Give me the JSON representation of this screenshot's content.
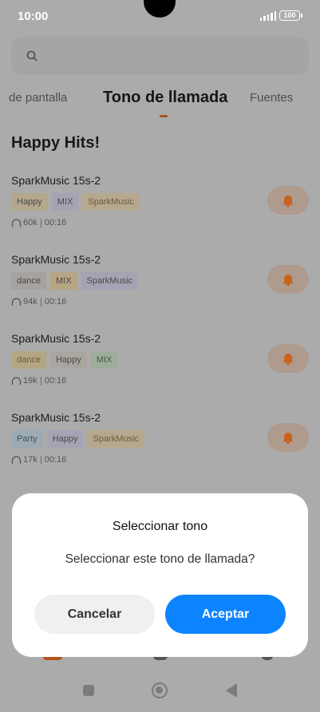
{
  "status_bar": {
    "time": "10:00",
    "battery": "100"
  },
  "search": {
    "placeholder": ""
  },
  "tabs": [
    {
      "label": "de pantalla"
    },
    {
      "label": "Tono de llamada"
    },
    {
      "label": "Fuentes"
    }
  ],
  "section_title": "Happy Hits!",
  "songs": [
    {
      "title": "SparkMusic 15s-2",
      "tags": [
        "Happy",
        "MIX",
        "SparkMusic"
      ],
      "plays": "60k",
      "duration": "00:16"
    },
    {
      "title": "SparkMusic 15s-2",
      "tags": [
        "dance",
        "MIX",
        "SparkMusic"
      ],
      "plays": "94k",
      "duration": "00:16"
    },
    {
      "title": "SparkMusic 15s-2",
      "tags": [
        "dance",
        "Happy",
        "MIX"
      ],
      "plays": "19k",
      "duration": "00:16"
    },
    {
      "title": "SparkMusic 15s-2",
      "tags": [
        "Party",
        "Happy",
        "SparkMusic"
      ],
      "plays": "17k",
      "duration": "00:16"
    }
  ],
  "dialog": {
    "title": "Seleccionar tono",
    "message": "Seleccionar este tono de llamada?",
    "cancel_label": "Cancelar",
    "accept_label": "Aceptar"
  },
  "colors": {
    "accent": "#0d84ff",
    "overlay": "#ababab",
    "bell": "#c8621c"
  },
  "icons": [
    "search-icon",
    "bell-icon",
    "headphones-icon",
    "recents-icon",
    "home-icon",
    "back-icon"
  ]
}
